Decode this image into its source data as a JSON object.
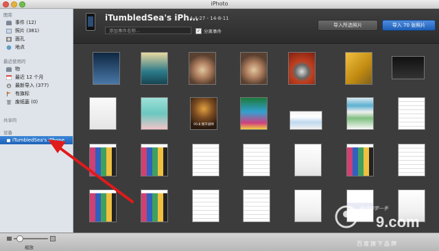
{
  "window": {
    "title": "iPhoto"
  },
  "sidebar": {
    "sections": {
      "library": "图库",
      "recent": "最近使用的",
      "shared": "共享的",
      "devices": "设备"
    },
    "library_items": [
      {
        "label": "事件 (12)",
        "icon": "events-icon"
      },
      {
        "label": "照片 (381)",
        "icon": "photos-icon"
      },
      {
        "label": "面孔",
        "icon": "faces-icon"
      },
      {
        "label": "地点",
        "icon": "places-icon"
      }
    ],
    "recent_items": [
      {
        "label": "物",
        "icon": "event-icon"
      },
      {
        "label": "最近 12 个月",
        "icon": "calendar-icon"
      },
      {
        "label": "最新导入 (377)",
        "icon": "import-icon"
      },
      {
        "label": "有旗标",
        "icon": "flag-icon"
      },
      {
        "label": "废纸篓 (0)",
        "icon": "trash-icon"
      }
    ],
    "device_item": {
      "label": "iTumbledSea's iPhone",
      "icon": "iphone-icon",
      "selected": true
    }
  },
  "import_header": {
    "device_name": "iTumbledSea's iPh...",
    "date_range": "14-4-27 - 14-8-11",
    "event_name_placeholder": "添加事件名称...",
    "split_events_label": "分离事件",
    "split_events_checked": true,
    "import_selected_label": "导入所选照片",
    "import_all_label": "导入 70 张照片"
  },
  "grid": {
    "rows": [
      [
        "wallpaper-blue",
        "wallpaper-teal",
        "photo-hands",
        "photo-hands",
        "photo-watch",
        "photo-box",
        "photo-apple"
      ],
      [
        "screenshot-calculator",
        "screenshot-cartoon",
        "photo-owl",
        "screenshot-homescreen",
        "screenshot-web",
        "screenshot-app",
        "screenshot-list"
      ],
      [
        "screenshot-mosaic",
        "screenshot-mosaic",
        "screenshot-list",
        "screenshot-list",
        "screenshot-doc",
        "screenshot-mosaic",
        "screenshot-list"
      ],
      [
        "screenshot-mosaic",
        "screenshot-mosaic",
        "screenshot-list",
        "screenshot-list",
        "screenshot-doc",
        "screenshot-chat",
        "screenshot-doc"
      ]
    ],
    "captions": {
      "owl": "05:8 周千语师"
    }
  },
  "toolbar": {
    "zoom_label": "缩放"
  },
  "watermark": {
    "brand": "9.com",
    "tagline": "百度旗下品牌",
    "script": "看动作学一手"
  },
  "colors": {
    "selection": "#2a6fc6",
    "arrow": "#e11a1a",
    "primary_button": "#2f72cd"
  }
}
